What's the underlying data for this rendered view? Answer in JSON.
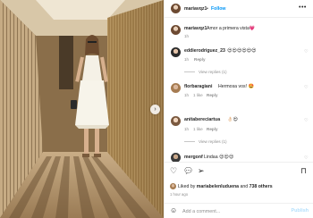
{
  "post": {
    "author": "mariavqz1",
    "separator": "•",
    "follow_label": "Follow",
    "more_label": "•••",
    "next_arrow": "›"
  },
  "caption": {
    "username": "mariavqz1",
    "text": "Amor a primera vista💗",
    "time": "1h"
  },
  "comments": [
    {
      "username": "eddierodriguez_23",
      "text": "😍😍😍😍😍😍",
      "time": "1h",
      "likes": "",
      "reply": "Reply",
      "view_replies": "View replies (1)"
    },
    {
      "username": "florbaragiani",
      "text": "Hermosa vos! 🤩",
      "time": "1h",
      "likes": "1 like",
      "reply": "Reply",
      "view_replies": ""
    },
    {
      "username": "anitabereciartua",
      "text": "👌🏻😍",
      "time": "1h",
      "likes": "1 like",
      "reply": "Reply",
      "view_replies": "View replies (1)"
    },
    {
      "username": "mergonf",
      "text": "Lindaa 😍😍😍",
      "time": "",
      "likes": "",
      "reply": "",
      "view_replies": ""
    }
  ],
  "likes": {
    "prefix": "Liked by",
    "liker": "mariabelenluduena",
    "connector": "and",
    "others": "738 others"
  },
  "post_time": "1 hour ago",
  "add_comment": {
    "placeholder": "Add a comment...",
    "publish_label": "Publish"
  },
  "icons": {
    "like": "heart-icon",
    "comment": "comment-icon",
    "share": "share-icon",
    "save": "bookmark-icon",
    "emoji": "emoji-icon"
  },
  "colors": {
    "accent": "#0095f6",
    "muted": "#8e8e8e",
    "publish_disabled": "#b2dffc"
  }
}
